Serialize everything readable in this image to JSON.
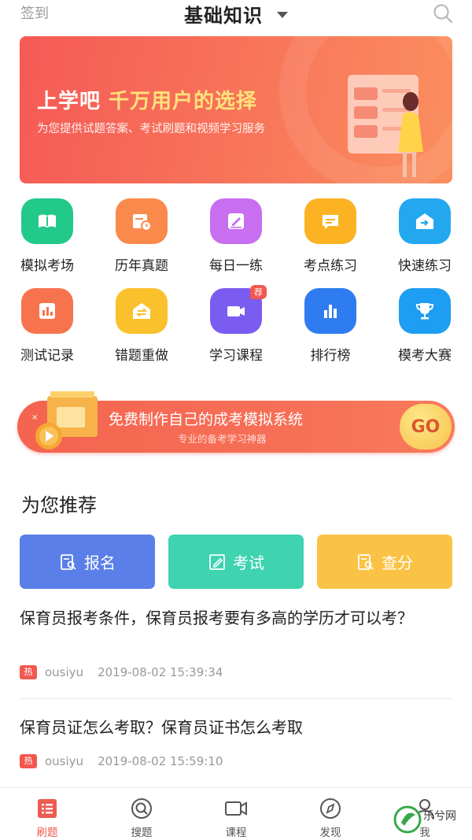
{
  "header": {
    "signin": "签到",
    "title": "基础知识"
  },
  "banner": {
    "title_part1": "上学吧",
    "title_part2": "千万用户的选择",
    "subtitle": "为您提供试题答案、考试刷题和视频学习服务"
  },
  "features": [
    {
      "label": "模拟考场",
      "icon": "book-icon",
      "color": "#22c98a"
    },
    {
      "label": "历年真题",
      "icon": "calendar-clock-icon",
      "color": "#fa8a4c"
    },
    {
      "label": "每日一练",
      "icon": "edit-icon",
      "color": "#c76ff0"
    },
    {
      "label": "考点练习",
      "icon": "chat-icon",
      "color": "#fbb324"
    },
    {
      "label": "快速练习",
      "icon": "arrow-box-icon",
      "color": "#23a8f0"
    },
    {
      "label": "测试记录",
      "icon": "bar-chart-icon",
      "color": "#f7734d"
    },
    {
      "label": "错题重做",
      "icon": "swap-icon",
      "color": "#fbc12c"
    },
    {
      "label": "学习课程",
      "icon": "video-icon",
      "color": "#7a5cf0",
      "badge": "荐"
    },
    {
      "label": "排行榜",
      "icon": "ranking-icon",
      "color": "#2f7cf0"
    },
    {
      "label": "模考大赛",
      "icon": "trophy-icon",
      "color": "#1e9ef2"
    }
  ],
  "promo": {
    "title": "免费制作自己的成考模拟系统",
    "subtitle": "专业的备考学习神器",
    "go": "GO"
  },
  "recommend": {
    "title": "为您推荐",
    "tiles": [
      {
        "label": "报名",
        "color": "#5b7fe8"
      },
      {
        "label": "考试",
        "color": "#3fd3b0"
      },
      {
        "label": "查分",
        "color": "#fbc346"
      }
    ]
  },
  "articles": [
    {
      "title": "保育员报考条件，保育员报考要有多高的学历才可以考？",
      "tag": "热",
      "author": "ousiyu",
      "time": "2019-08-02 15:39:34"
    },
    {
      "title": "保育员证怎么考取？保育员证书怎么考取",
      "tag": "热",
      "author": "ousiyu",
      "time": "2019-08-02 15:59:10"
    }
  ],
  "tabbar": {
    "tabs": [
      {
        "label": "刷题",
        "icon": "list-icon",
        "active": true
      },
      {
        "label": "搜题",
        "icon": "search-circle-icon"
      },
      {
        "label": "课程",
        "icon": "video-camera-icon"
      },
      {
        "label": "发现",
        "icon": "compass-icon"
      },
      {
        "label": "我",
        "icon": "user-icon"
      }
    ]
  },
  "watermark": {
    "text": "乐兮网"
  }
}
